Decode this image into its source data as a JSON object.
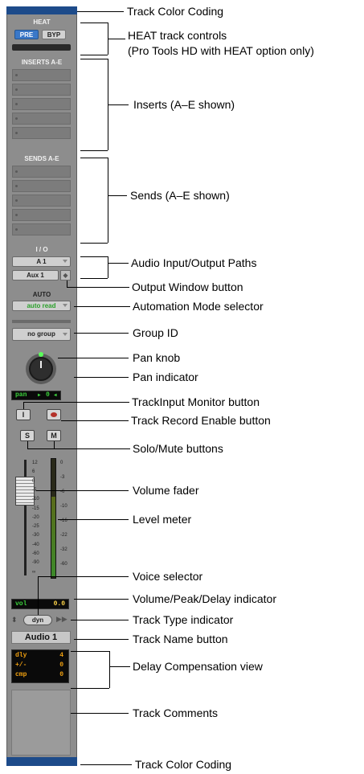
{
  "strip": {
    "heat_label": "HEAT",
    "heat_pre": "PRE",
    "heat_byp": "BYP",
    "inserts_label": "INSERTS A-E",
    "sends_label": "SENDS A-E",
    "io_label": "I / O",
    "io_input": "A 1",
    "io_output": "Aux 1",
    "auto_label": "AUTO",
    "auto_mode": "auto read",
    "group": "no group",
    "pan_label": "pan",
    "pan_value": "0",
    "input_btn": "I",
    "solo_btn": "S",
    "mute_btn": "M",
    "fader_scale": [
      "12",
      "6",
      "0",
      "-5",
      "-10",
      "-15",
      "-20",
      "-25",
      "-30",
      "-40",
      "-60",
      "-90",
      "∞"
    ],
    "meter_scale": [
      "0",
      "-3",
      "-6",
      "-10",
      "-16",
      "-22",
      "-32",
      "-60"
    ],
    "vol_label": "vol",
    "vol_value": "0.0",
    "voice": "dyn",
    "track_name": "Audio 1",
    "delay": {
      "dly_label": "dly",
      "dly_value": "4",
      "pm_label": "+/-",
      "pm_value": "0",
      "cmp_label": "cmp",
      "cmp_value": "0"
    }
  },
  "annotations": {
    "top_color": "Track Color Coding",
    "heat_line1": "HEAT track controls",
    "heat_line2": "(Pro Tools HD with HEAT option only)",
    "inserts": "Inserts (A–E shown)",
    "sends": "Sends (A–E shown)",
    "io_paths": "Audio Input/Output Paths",
    "output_window": "Output Window button",
    "automation": "Automation Mode selector",
    "group_id": "Group ID",
    "pan_knob": "Pan knob",
    "pan_indicator": "Pan indicator",
    "input_monitor": "TrackInput Monitor button",
    "record_enable": "Track Record Enable button",
    "solo_mute": "Solo/Mute buttons",
    "volume_fader": "Volume fader",
    "level_meter": "Level meter",
    "voice_selector": "Voice selector",
    "vol_peak": "Volume/Peak/Delay indicator",
    "track_type": "Track Type indicator",
    "track_name": "Track Name button",
    "delay_comp": "Delay Compensation view",
    "comments": "Track Comments",
    "bottom_color": "Track Color Coding"
  },
  "colors": {
    "track_color": "#1d4b8a",
    "strip_bg": "#8d8d8d",
    "lcd_green": "#3cd23c",
    "lcd_orange": "#f0a010",
    "heat_blue": "#3a78c8",
    "record_red": "#b4322a"
  }
}
